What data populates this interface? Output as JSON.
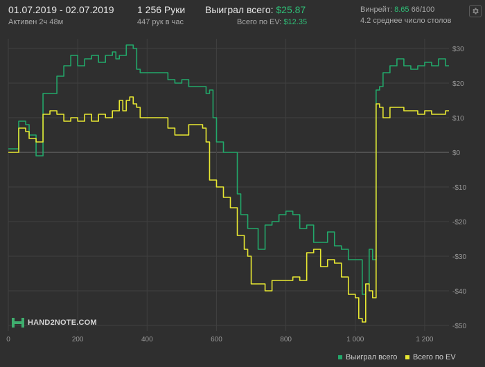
{
  "header": {
    "date_range": "01.07.2019 - 02.07.2019",
    "active_time": "Активен 2ч 48м",
    "hands": "1 256 Руки",
    "hands_per_hour": "447 рук в час",
    "won_total_label": "Выиграл всего:",
    "won_total_value": "$25.87",
    "ev_total_label": "Всего по EV:",
    "ev_total_value": "$12.35",
    "winrate_label": "Винрейт:",
    "winrate_value": "8.65",
    "winrate_suffix": "66/100",
    "avg_tables": "4.2 среднее число столов"
  },
  "logo": {
    "text": "HAND2NOTE.COM"
  },
  "colors": {
    "background": "#2f2f2f",
    "grid": "#404040",
    "zero_line": "#707070",
    "won_series": "#22a86a",
    "ev_series": "#e8e832",
    "accent_green": "#2fbf77"
  },
  "chart_data": {
    "type": "line",
    "x_ticks": [
      "0",
      "200",
      "400",
      "600",
      "800",
      "1 000",
      "1 200"
    ],
    "y_ticks": [
      "$30",
      "$20",
      "$10",
      "$0",
      "-$10",
      "-$20",
      "-$30",
      "-$40",
      "-$50"
    ],
    "xlim": [
      0,
      1270
    ],
    "ylim": [
      -51,
      31
    ],
    "grid": true,
    "legend_placement": "bottom-right",
    "series": [
      {
        "name": "Выиграл всего",
        "color": "#22a86a",
        "points": [
          [
            0,
            1
          ],
          [
            20,
            1
          ],
          [
            30,
            9
          ],
          [
            50,
            8
          ],
          [
            60,
            5
          ],
          [
            80,
            -1
          ],
          [
            100,
            17
          ],
          [
            140,
            22
          ],
          [
            160,
            25
          ],
          [
            180,
            28
          ],
          [
            200,
            25
          ],
          [
            220,
            27
          ],
          [
            240,
            28
          ],
          [
            260,
            26
          ],
          [
            280,
            28
          ],
          [
            300,
            29
          ],
          [
            310,
            27
          ],
          [
            320,
            28
          ],
          [
            340,
            31
          ],
          [
            360,
            30
          ],
          [
            370,
            24
          ],
          [
            380,
            23
          ],
          [
            400,
            23
          ],
          [
            420,
            23
          ],
          [
            440,
            23
          ],
          [
            460,
            21
          ],
          [
            480,
            20
          ],
          [
            500,
            21
          ],
          [
            520,
            19
          ],
          [
            540,
            19
          ],
          [
            560,
            19
          ],
          [
            570,
            17
          ],
          [
            580,
            18
          ],
          [
            590,
            10
          ],
          [
            600,
            3
          ],
          [
            620,
            0
          ],
          [
            640,
            0
          ],
          [
            660,
            -12
          ],
          [
            670,
            -18
          ],
          [
            690,
            -22
          ],
          [
            710,
            -22
          ],
          [
            720,
            -28
          ],
          [
            740,
            -21
          ],
          [
            760,
            -20
          ],
          [
            780,
            -18
          ],
          [
            800,
            -17
          ],
          [
            820,
            -18
          ],
          [
            840,
            -22
          ],
          [
            860,
            -21
          ],
          [
            880,
            -26
          ],
          [
            900,
            -26
          ],
          [
            920,
            -23
          ],
          [
            940,
            -27
          ],
          [
            960,
            -28
          ],
          [
            980,
            -31
          ],
          [
            1000,
            -31
          ],
          [
            1020,
            -41
          ],
          [
            1030,
            -38
          ],
          [
            1040,
            -28
          ],
          [
            1050,
            -31
          ],
          [
            1060,
            18
          ],
          [
            1070,
            19
          ],
          [
            1080,
            23
          ],
          [
            1100,
            25
          ],
          [
            1120,
            27
          ],
          [
            1140,
            25
          ],
          [
            1160,
            24
          ],
          [
            1180,
            25
          ],
          [
            1200,
            26
          ],
          [
            1220,
            25
          ],
          [
            1240,
            27
          ],
          [
            1260,
            25
          ],
          [
            1270,
            25
          ]
        ]
      },
      {
        "name": "Всего по EV",
        "color": "#e8e832",
        "points": [
          [
            0,
            0
          ],
          [
            20,
            0
          ],
          [
            30,
            7
          ],
          [
            50,
            6
          ],
          [
            60,
            4
          ],
          [
            80,
            3
          ],
          [
            100,
            11
          ],
          [
            120,
            12
          ],
          [
            140,
            11
          ],
          [
            160,
            9
          ],
          [
            180,
            10
          ],
          [
            200,
            9
          ],
          [
            220,
            11
          ],
          [
            240,
            9
          ],
          [
            260,
            11
          ],
          [
            280,
            10
          ],
          [
            300,
            12
          ],
          [
            320,
            15
          ],
          [
            330,
            12
          ],
          [
            340,
            15
          ],
          [
            350,
            16
          ],
          [
            360,
            14
          ],
          [
            370,
            13
          ],
          [
            380,
            10
          ],
          [
            400,
            10
          ],
          [
            420,
            10
          ],
          [
            440,
            10
          ],
          [
            460,
            7
          ],
          [
            480,
            5
          ],
          [
            500,
            5
          ],
          [
            520,
            8
          ],
          [
            540,
            8
          ],
          [
            560,
            7
          ],
          [
            570,
            3
          ],
          [
            580,
            -8
          ],
          [
            600,
            -10
          ],
          [
            620,
            -13
          ],
          [
            640,
            -16
          ],
          [
            660,
            -24
          ],
          [
            680,
            -28
          ],
          [
            690,
            -30
          ],
          [
            700,
            -38
          ],
          [
            720,
            -38
          ],
          [
            740,
            -40
          ],
          [
            760,
            -37
          ],
          [
            780,
            -37
          ],
          [
            800,
            -37
          ],
          [
            820,
            -36
          ],
          [
            840,
            -37
          ],
          [
            860,
            -29
          ],
          [
            880,
            -28
          ],
          [
            900,
            -33
          ],
          [
            920,
            -31
          ],
          [
            940,
            -32
          ],
          [
            960,
            -36
          ],
          [
            980,
            -41
          ],
          [
            1000,
            -42
          ],
          [
            1010,
            -48
          ],
          [
            1020,
            -49
          ],
          [
            1030,
            -38
          ],
          [
            1040,
            -40
          ],
          [
            1050,
            -42
          ],
          [
            1060,
            14
          ],
          [
            1070,
            13
          ],
          [
            1080,
            10
          ],
          [
            1100,
            13
          ],
          [
            1120,
            13
          ],
          [
            1140,
            12
          ],
          [
            1160,
            12
          ],
          [
            1180,
            11
          ],
          [
            1200,
            12
          ],
          [
            1220,
            11
          ],
          [
            1240,
            11
          ],
          [
            1260,
            12
          ],
          [
            1270,
            12
          ]
        ]
      }
    ]
  },
  "legend": {
    "won_label": "Выиграл всего",
    "ev_label": "Всего по EV"
  }
}
